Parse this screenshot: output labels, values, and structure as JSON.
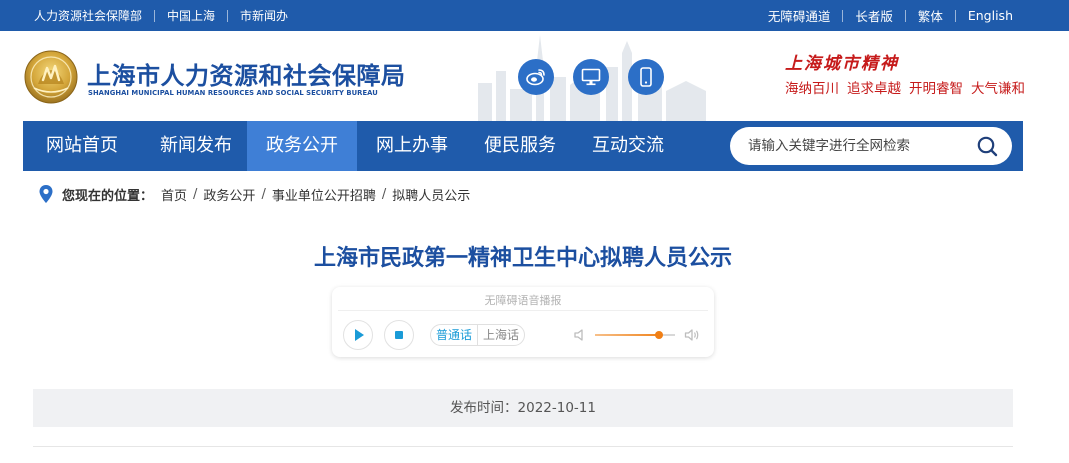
{
  "topbar": {
    "left_links": [
      "人力资源社会保障部",
      "中国上海",
      "市新闻办"
    ],
    "right_links": [
      "无障碍通道",
      "长者版",
      "繁体",
      "English"
    ]
  },
  "header": {
    "title": "上海市人力资源和社会保障局",
    "subtitle": "SHANGHAI MUNICIPAL HUMAN RESOURCES AND SOCIAL SECURITY BUREAU",
    "emblem_icon": "shanghai-emblem-icon",
    "quick_icons": [
      "weibo-icon",
      "desktop-icon",
      "mobile-icon"
    ],
    "spirit_title": "上海城市精神",
    "spirit_phrases": [
      "海纳百川",
      "追求卓越",
      "开明睿智",
      "大气谦和"
    ],
    "colors": {
      "primary": "#1f5bab",
      "nav_active": "#3f7fd6",
      "spirit_red": "#c61b1b"
    }
  },
  "nav": {
    "items": [
      "网站首页",
      "新闻发布",
      "政务公开",
      "网上办事",
      "便民服务",
      "互动交流"
    ],
    "active_index": 2,
    "search_placeholder": "请输入关键字进行全网检索"
  },
  "breadcrumb": {
    "lead": "您现在的位置：",
    "items": [
      "首页",
      "政务公开",
      "事业单位公开招聘",
      "拟聘人员公示"
    ]
  },
  "article": {
    "title": "上海市民政第一精神卫生中心拟聘人员公示",
    "publish_label": "发布时间：",
    "publish_date": "2022-10-11"
  },
  "player": {
    "label": "无障碍语音播报",
    "languages": [
      "普通话",
      "上海话"
    ],
    "selected_language": "普通话",
    "volume_fraction": 0.8,
    "accent_color": "#f07f15"
  }
}
